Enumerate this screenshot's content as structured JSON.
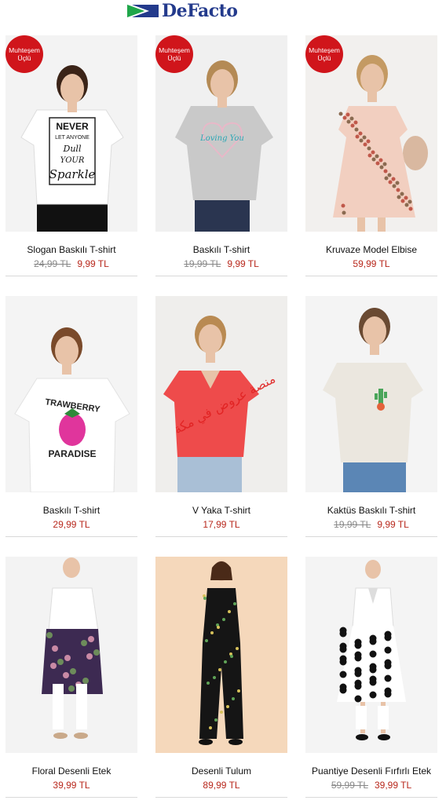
{
  "brand": {
    "name": "DeFacto"
  },
  "badge": {
    "line1": "Muhteşem",
    "line2": "Üçlü"
  },
  "watermark": "منصة عروض في مكة",
  "currency": "TL",
  "products": [
    {
      "name": "Slogan Baskılı T-shirt",
      "old_price": "24,99 TL",
      "price": "9,99 TL",
      "badge": true,
      "style": "tee-white-slogan"
    },
    {
      "name": "Baskılı T-shirt",
      "old_price": "19,99 TL",
      "price": "9,99 TL",
      "badge": true,
      "style": "tee-grey-heart"
    },
    {
      "name": "Kruvaze Model Elbise",
      "old_price": "",
      "price": "59,99 TL",
      "badge": true,
      "style": "dress-floral-pink"
    },
    {
      "name": "Baskılı T-shirt",
      "old_price": "",
      "price": "29,99 TL",
      "badge": false,
      "style": "tee-white-strawberry"
    },
    {
      "name": "V Yaka T-shirt",
      "old_price": "",
      "price": "17,99 TL",
      "badge": false,
      "style": "tee-red-vneck"
    },
    {
      "name": "Kaktüs Baskılı T-shirt",
      "old_price": "19,99 TL",
      "price": "9,99 TL",
      "badge": false,
      "style": "tee-beige-cactus"
    },
    {
      "name": "Floral Desenli Etek",
      "old_price": "",
      "price": "39,99 TL",
      "badge": false,
      "style": "skirt-floral-navy"
    },
    {
      "name": "Desenli Tulum",
      "old_price": "",
      "price": "89,99 TL",
      "badge": false,
      "style": "jumpsuit-black-floral"
    },
    {
      "name": "Puantiye Desenli Fırfırlı Etek",
      "old_price": "59,99 TL",
      "price": "39,99 TL",
      "badge": false,
      "style": "skirt-polka-dot"
    }
  ],
  "print_text": {
    "p1": [
      "NEVER",
      "LET ANYONE",
      "Dull",
      "YOUR",
      "Sparkle"
    ],
    "p2": "Loving You",
    "p4": [
      "TRAWBERRY",
      "PARADISE"
    ]
  }
}
